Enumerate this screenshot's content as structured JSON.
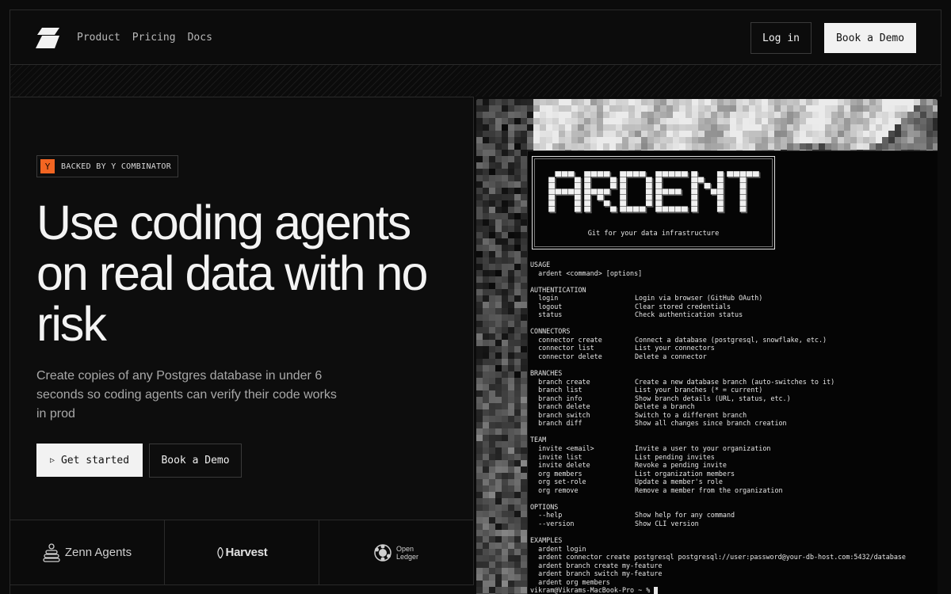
{
  "nav": {
    "links": [
      "Product",
      "Pricing",
      "Docs"
    ],
    "login_label": "Log in",
    "demo_label": "Book a Demo"
  },
  "hero": {
    "badge_letter": "Y",
    "badge_text": "BACKED BY Y COMBINATOR",
    "headline": "Use coding agents on real data with no risk",
    "subtext": "Create copies of any Postgres database in under 6 seconds so coding agents can verify their code works in prod",
    "cta_primary": "Get started",
    "cta_secondary": "Book a Demo"
  },
  "logos": [
    {
      "name": "Zenn Agents",
      "icon": "stack-icon"
    },
    {
      "name": "Harvest",
      "icon": "leaf-icon"
    },
    {
      "name": "Open Ledger",
      "line1": "Open",
      "line2": "Ledger",
      "icon": "hex-icon"
    }
  ],
  "terminal": {
    "ascii_title": "ARDENT",
    "tagline": "Git for your data infrastructure",
    "sections": [
      {
        "title": "USAGE",
        "rows": [
          [
            "ardent <command> [options]",
            ""
          ]
        ]
      },
      {
        "title": "AUTHENTICATION",
        "rows": [
          [
            "login",
            "Login via browser (GitHub OAuth)"
          ],
          [
            "logout",
            "Clear stored credentials"
          ],
          [
            "status",
            "Check authentication status"
          ]
        ]
      },
      {
        "title": "CONNECTORS",
        "rows": [
          [
            "connector create",
            "Connect a database (postgresql, snowflake, etc.)"
          ],
          [
            "connector list",
            "List your connectors"
          ],
          [
            "connector delete",
            "Delete a connector"
          ]
        ]
      },
      {
        "title": "BRANCHES",
        "rows": [
          [
            "branch create",
            "Create a new database branch (auto-switches to it)"
          ],
          [
            "branch list",
            "List your branches (* = current)"
          ],
          [
            "branch info",
            "Show branch details (URL, status, etc.)"
          ],
          [
            "branch delete",
            "Delete a branch"
          ],
          [
            "branch switch",
            "Switch to a different branch"
          ],
          [
            "branch diff",
            "Show all changes since branch creation"
          ]
        ]
      },
      {
        "title": "TEAM",
        "rows": [
          [
            "invite <email>",
            "Invite a user to your organization"
          ],
          [
            "invite list",
            "List pending invites"
          ],
          [
            "invite delete",
            "Revoke a pending invite"
          ],
          [
            "org members",
            "List organization members"
          ],
          [
            "org set-role",
            "Update a member's role"
          ],
          [
            "org remove",
            "Remove a member from the organization"
          ]
        ]
      },
      {
        "title": "OPTIONS",
        "rows": [
          [
            "--help",
            "Show help for any command"
          ],
          [
            "--version",
            "Show CLI version"
          ]
        ]
      },
      {
        "title": "EXAMPLES",
        "rows": [
          [
            "ardent login",
            ""
          ],
          [
            "ardent connector create postgresql postgresql://user:password@your-db-host.com:5432/database",
            ""
          ],
          [
            "ardent branch create my-feature",
            ""
          ],
          [
            "ardent branch switch my-feature",
            ""
          ],
          [
            "ardent org members",
            ""
          ]
        ]
      }
    ],
    "prompt": "vikram@Vikrams-MacBook-Pro ~ % "
  }
}
